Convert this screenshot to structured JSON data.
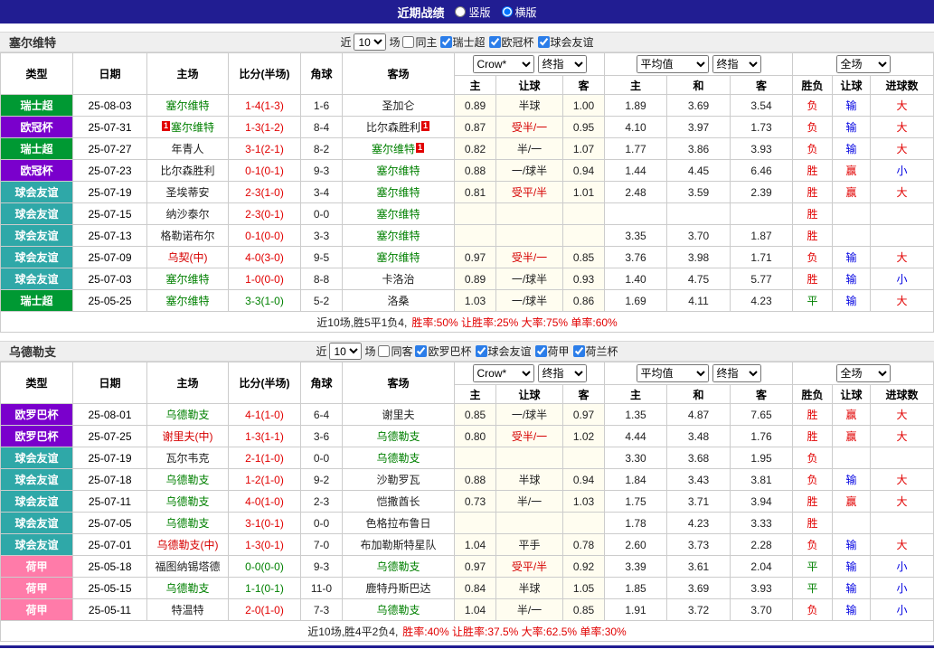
{
  "titlebar": {
    "title": "近期战绩",
    "radio_group": [
      {
        "label": "竖版",
        "checked": false
      },
      {
        "label": "横版",
        "checked": true
      }
    ]
  },
  "colors": {
    "titlebar_bg": "#211D92",
    "result_red": "#E10000",
    "result_blue": "#0000E1",
    "result_green": "#008000",
    "focal_green": "#008000",
    "neutral_red": "#D60000",
    "score_red": "#E10000",
    "score_green": "#008000",
    "handicap_bg": "#FFFDF0",
    "section_bg": "#EFEFEF",
    "border": "#CCCCCC"
  },
  "league_colors": {
    "瑞士超": "#009933",
    "欧冠杯": "#7A00CC",
    "球会友谊": "#2FA8A8",
    "欧罗巴杯": "#7A00CC",
    "荷甲": "#FF7BA9"
  },
  "sections": [
    {
      "team": "塞尔维特",
      "filter": {
        "near_label": "近",
        "count": "10",
        "matches_label": "场",
        "same_label": "同主",
        "same_checked": false,
        "leagues": [
          {
            "label": "瑞士超",
            "checked": true
          },
          {
            "label": "欧冠杯",
            "checked": true
          },
          {
            "label": "球会友谊",
            "checked": true
          }
        ]
      },
      "header": {
        "cols": [
          "类型",
          "日期",
          "主场",
          "比分(半场)",
          "角球",
          "客场"
        ],
        "bookmaker": "Crow*",
        "handicap_final": "终指",
        "euro_avg": "平均值",
        "euro_final": "终指",
        "fulltime": "全场",
        "sub": [
          "主",
          "让球",
          "客",
          "主",
          "和",
          "客",
          "胜负",
          "让球",
          "进球数"
        ]
      },
      "rows": [
        {
          "lg": "瑞士超",
          "date": "25-08-03",
          "home": {
            "t": "塞尔维特",
            "s": "f"
          },
          "sc": "1-4(1-3)",
          "scc": "r",
          "cor": "1-6",
          "away": {
            "t": "圣加仑",
            "s": "n"
          },
          "h1": "0.89",
          "hl": "半球",
          "hlr": false,
          "h2": "1.00",
          "e1": "1.89",
          "e2": "3.69",
          "e3": "3.54",
          "r1": "负",
          "r2": "输",
          "r3": "大"
        },
        {
          "lg": "欧冠杯",
          "date": "25-07-31",
          "home": {
            "t": "塞尔维特",
            "s": "f",
            "pre": "1"
          },
          "sc": "1-3(1-2)",
          "scc": "r",
          "cor": "8-4",
          "away": {
            "t": "比尔森胜利",
            "s": "n",
            "post": "1"
          },
          "h1": "0.87",
          "hl": "受半/一",
          "hlr": true,
          "h2": "0.95",
          "e1": "4.10",
          "e2": "3.97",
          "e3": "1.73",
          "r1": "负",
          "r2": "输",
          "r3": "大"
        },
        {
          "lg": "瑞士超",
          "date": "25-07-27",
          "home": {
            "t": "年青人",
            "s": "n"
          },
          "sc": "3-1(2-1)",
          "scc": "r",
          "cor": "8-2",
          "away": {
            "t": "塞尔维特",
            "s": "f",
            "post": "1"
          },
          "h1": "0.82",
          "hl": "半/一",
          "hlr": false,
          "h2": "1.07",
          "e1": "1.77",
          "e2": "3.86",
          "e3": "3.93",
          "r1": "负",
          "r2": "输",
          "r3": "大"
        },
        {
          "lg": "欧冠杯",
          "date": "25-07-23",
          "home": {
            "t": "比尔森胜利",
            "s": "n"
          },
          "sc": "0-1(0-1)",
          "scc": "r",
          "cor": "9-3",
          "away": {
            "t": "塞尔维特",
            "s": "f"
          },
          "h1": "0.88",
          "hl": "一/球半",
          "hlr": false,
          "h2": "0.94",
          "e1": "1.44",
          "e2": "4.45",
          "e3": "6.46",
          "r1": "胜",
          "r2": "赢",
          "r3": "小"
        },
        {
          "lg": "球会友谊",
          "date": "25-07-19",
          "home": {
            "t": "圣埃蒂安",
            "s": "n"
          },
          "sc": "2-3(1-0)",
          "scc": "r",
          "cor": "3-4",
          "away": {
            "t": "塞尔维特",
            "s": "f"
          },
          "h1": "0.81",
          "hl": "受平/半",
          "hlr": true,
          "h2": "1.01",
          "e1": "2.48",
          "e2": "3.59",
          "e3": "2.39",
          "r1": "胜",
          "r2": "赢",
          "r3": "大"
        },
        {
          "lg": "球会友谊",
          "date": "25-07-15",
          "home": {
            "t": "纳沙泰尔",
            "s": "n"
          },
          "sc": "2-3(0-1)",
          "scc": "r",
          "cor": "0-0",
          "away": {
            "t": "塞尔维特",
            "s": "f"
          },
          "h1": "",
          "hl": "",
          "hlr": false,
          "h2": "",
          "e1": "",
          "e2": "",
          "e3": "",
          "r1": "胜",
          "r2": "",
          "r3": ""
        },
        {
          "lg": "球会友谊",
          "date": "25-07-13",
          "home": {
            "t": "格勒诺布尔",
            "s": "n"
          },
          "sc": "0-1(0-0)",
          "scc": "r",
          "cor": "3-3",
          "away": {
            "t": "塞尔维特",
            "s": "f"
          },
          "h1": "",
          "hl": "",
          "hlr": false,
          "h2": "",
          "e1": "3.35",
          "e2": "3.70",
          "e3": "1.87",
          "r1": "胜",
          "r2": "",
          "r3": ""
        },
        {
          "lg": "球会友谊",
          "date": "25-07-09",
          "home": {
            "t": "乌契(中)",
            "s": "m"
          },
          "sc": "4-0(3-0)",
          "scc": "r",
          "cor": "9-5",
          "away": {
            "t": "塞尔维特",
            "s": "f"
          },
          "h1": "0.97",
          "hl": "受半/一",
          "hlr": true,
          "h2": "0.85",
          "e1": "3.76",
          "e2": "3.98",
          "e3": "1.71",
          "r1": "负",
          "r2": "输",
          "r3": "大"
        },
        {
          "lg": "球会友谊",
          "date": "25-07-03",
          "home": {
            "t": "塞尔维特",
            "s": "f"
          },
          "sc": "1-0(0-0)",
          "scc": "r",
          "cor": "8-8",
          "away": {
            "t": "卡洛治",
            "s": "n"
          },
          "h1": "0.89",
          "hl": "一/球半",
          "hlr": false,
          "h2": "0.93",
          "e1": "1.40",
          "e2": "4.75",
          "e3": "5.77",
          "r1": "胜",
          "r2": "输",
          "r3": "小"
        },
        {
          "lg": "瑞士超",
          "date": "25-05-25",
          "home": {
            "t": "塞尔维特",
            "s": "f"
          },
          "sc": "3-3(1-0)",
          "scc": "g",
          "cor": "5-2",
          "away": {
            "t": "洛桑",
            "s": "n"
          },
          "h1": "1.03",
          "hl": "一/球半",
          "hlr": false,
          "h2": "0.86",
          "e1": "1.69",
          "e2": "4.11",
          "e3": "4.23",
          "r1": "平",
          "r2": "输",
          "r3": "大"
        }
      ],
      "summary_record": "近10场,胜5平1负4,",
      "summary_rates": "胜率:50% 让胜率:25% 大率:75% 单率:60%"
    },
    {
      "team": "乌德勒支",
      "filter": {
        "near_label": "近",
        "count": "10",
        "matches_label": "场",
        "same_label": "同客",
        "same_checked": false,
        "leagues": [
          {
            "label": "欧罗巴杯",
            "checked": true
          },
          {
            "label": "球会友谊",
            "checked": true
          },
          {
            "label": "荷甲",
            "checked": true
          },
          {
            "label": "荷兰杯",
            "checked": true
          }
        ]
      },
      "header": {
        "cols": [
          "类型",
          "日期",
          "主场",
          "比分(半场)",
          "角球",
          "客场"
        ],
        "bookmaker": "Crow*",
        "handicap_final": "终指",
        "euro_avg": "平均值",
        "euro_final": "终指",
        "fulltime": "全场",
        "sub": [
          "主",
          "让球",
          "客",
          "主",
          "和",
          "客",
          "胜负",
          "让球",
          "进球数"
        ]
      },
      "rows": [
        {
          "lg": "欧罗巴杯",
          "date": "25-08-01",
          "home": {
            "t": "乌德勒支",
            "s": "f"
          },
          "sc": "4-1(1-0)",
          "scc": "r",
          "cor": "6-4",
          "away": {
            "t": "谢里夫",
            "s": "n"
          },
          "h1": "0.85",
          "hl": "一/球半",
          "hlr": false,
          "h2": "0.97",
          "e1": "1.35",
          "e2": "4.87",
          "e3": "7.65",
          "r1": "胜",
          "r2": "赢",
          "r3": "大"
        },
        {
          "lg": "欧罗巴杯",
          "date": "25-07-25",
          "home": {
            "t": "谢里夫(中)",
            "s": "m"
          },
          "sc": "1-3(1-1)",
          "scc": "r",
          "cor": "3-6",
          "away": {
            "t": "乌德勒支",
            "s": "f"
          },
          "h1": "0.80",
          "hl": "受半/一",
          "hlr": true,
          "h2": "1.02",
          "e1": "4.44",
          "e2": "3.48",
          "e3": "1.76",
          "r1": "胜",
          "r2": "赢",
          "r3": "大"
        },
        {
          "lg": "球会友谊",
          "date": "25-07-19",
          "home": {
            "t": "瓦尔韦克",
            "s": "n"
          },
          "sc": "2-1(1-0)",
          "scc": "r",
          "cor": "0-0",
          "away": {
            "t": "乌德勒支",
            "s": "f"
          },
          "h1": "",
          "hl": "",
          "hlr": false,
          "h2": "",
          "e1": "3.30",
          "e2": "3.68",
          "e3": "1.95",
          "r1": "负",
          "r2": "",
          "r3": ""
        },
        {
          "lg": "球会友谊",
          "date": "25-07-18",
          "home": {
            "t": "乌德勒支",
            "s": "f"
          },
          "sc": "1-2(1-0)",
          "scc": "r",
          "cor": "9-2",
          "away": {
            "t": "沙勒罗瓦",
            "s": "n"
          },
          "h1": "0.88",
          "hl": "半球",
          "hlr": false,
          "h2": "0.94",
          "e1": "1.84",
          "e2": "3.43",
          "e3": "3.81",
          "r1": "负",
          "r2": "输",
          "r3": "大"
        },
        {
          "lg": "球会友谊",
          "date": "25-07-11",
          "home": {
            "t": "乌德勒支",
            "s": "f"
          },
          "sc": "4-0(1-0)",
          "scc": "r",
          "cor": "2-3",
          "away": {
            "t": "恺撒酋长",
            "s": "n"
          },
          "h1": "0.73",
          "hl": "半/一",
          "hlr": false,
          "h2": "1.03",
          "e1": "1.75",
          "e2": "3.71",
          "e3": "3.94",
          "r1": "胜",
          "r2": "赢",
          "r3": "大"
        },
        {
          "lg": "球会友谊",
          "date": "25-07-05",
          "home": {
            "t": "乌德勒支",
            "s": "f"
          },
          "sc": "3-1(0-1)",
          "scc": "r",
          "cor": "0-0",
          "away": {
            "t": "色格拉布鲁日",
            "s": "n"
          },
          "h1": "",
          "hl": "",
          "hlr": false,
          "h2": "",
          "e1": "1.78",
          "e2": "4.23",
          "e3": "3.33",
          "r1": "胜",
          "r2": "",
          "r3": ""
        },
        {
          "lg": "球会友谊",
          "date": "25-07-01",
          "home": {
            "t": "乌德勒支(中)",
            "s": "m"
          },
          "sc": "1-3(0-1)",
          "scc": "r",
          "cor": "7-0",
          "away": {
            "t": "布加勒斯特星队",
            "s": "n"
          },
          "h1": "1.04",
          "hl": "平手",
          "hlr": false,
          "h2": "0.78",
          "e1": "2.60",
          "e2": "3.73",
          "e3": "2.28",
          "r1": "负",
          "r2": "输",
          "r3": "大"
        },
        {
          "lg": "荷甲",
          "date": "25-05-18",
          "home": {
            "t": "福图纳锡塔德",
            "s": "n"
          },
          "sc": "0-0(0-0)",
          "scc": "g",
          "cor": "9-3",
          "away": {
            "t": "乌德勒支",
            "s": "f"
          },
          "h1": "0.97",
          "hl": "受平/半",
          "hlr": true,
          "h2": "0.92",
          "e1": "3.39",
          "e2": "3.61",
          "e3": "2.04",
          "r1": "平",
          "r2": "输",
          "r3": "小"
        },
        {
          "lg": "荷甲",
          "date": "25-05-15",
          "home": {
            "t": "乌德勒支",
            "s": "f"
          },
          "sc": "1-1(0-1)",
          "scc": "g",
          "cor": "11-0",
          "away": {
            "t": "鹿特丹斯巴达",
            "s": "n"
          },
          "h1": "0.84",
          "hl": "半球",
          "hlr": false,
          "h2": "1.05",
          "e1": "1.85",
          "e2": "3.69",
          "e3": "3.93",
          "r1": "平",
          "r2": "输",
          "r3": "小"
        },
        {
          "lg": "荷甲",
          "date": "25-05-11",
          "home": {
            "t": "特温特",
            "s": "n"
          },
          "sc": "2-0(1-0)",
          "scc": "r",
          "cor": "7-3",
          "away": {
            "t": "乌德勒支",
            "s": "f"
          },
          "h1": "1.04",
          "hl": "半/一",
          "hlr": false,
          "h2": "0.85",
          "e1": "1.91",
          "e2": "3.72",
          "e3": "3.70",
          "r1": "负",
          "r2": "输",
          "r3": "小"
        }
      ],
      "summary_record": "近10场,胜4平2负4,",
      "summary_rates": "胜率:40% 让胜率:37.5% 大率:62.5% 单率:30%"
    }
  ]
}
